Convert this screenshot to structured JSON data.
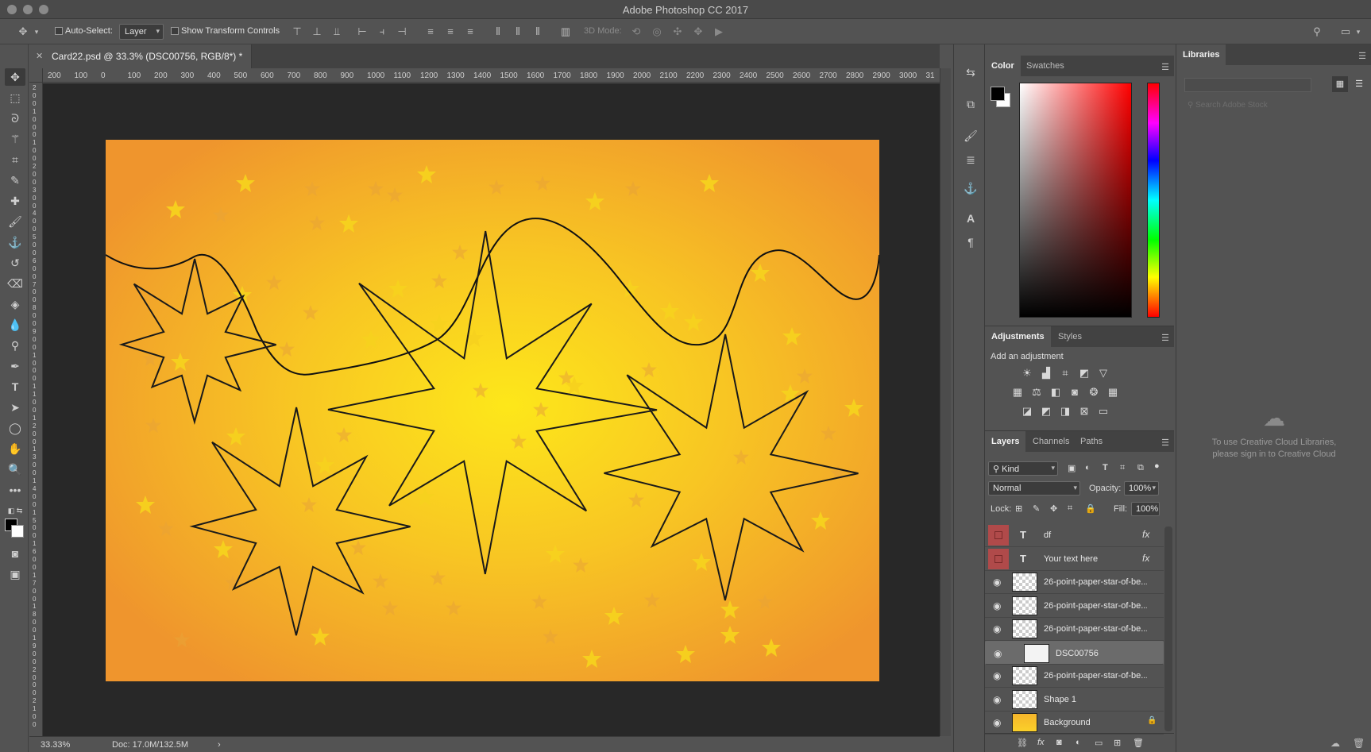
{
  "window": {
    "title": "Adobe Photoshop CC 2017"
  },
  "options_bar": {
    "auto_select_label": "Auto-Select:",
    "auto_select_value": "Layer",
    "show_transform_label": "Show Transform Controls",
    "mode_3d_label": "3D Mode:"
  },
  "document": {
    "tab_title": "Card22.psd @ 33.3% (DSC00756, RGB/8*) *",
    "ruler_ticks": [
      "200",
      "100",
      "0",
      "100",
      "200",
      "300",
      "400",
      "500",
      "600",
      "700",
      "800",
      "900",
      "1000",
      "1100",
      "1200",
      "1300",
      "1400",
      "1500",
      "1600",
      "1700",
      "1800",
      "1900",
      "2000",
      "2100",
      "2200",
      "2300",
      "2400",
      "2500",
      "2600",
      "2700",
      "2800",
      "2900",
      "3000",
      "31"
    ],
    "vruler_ticks": [
      "2",
      "0",
      "0",
      "1",
      "0",
      "0",
      "0",
      "1",
      "0",
      "0",
      "2",
      "0",
      "0",
      "3",
      "0",
      "0",
      "4",
      "0",
      "0",
      "5",
      "0",
      "0",
      "6",
      "0",
      "0",
      "7",
      "0",
      "0",
      "8",
      "0",
      "0",
      "9",
      "0",
      "0",
      "1",
      "0",
      "0",
      "0",
      "1",
      "1",
      "0",
      "0",
      "1",
      "2",
      "0",
      "0",
      "1",
      "3",
      "0",
      "0",
      "1",
      "4",
      "0",
      "0",
      "1",
      "5",
      "0",
      "0",
      "1",
      "6",
      "0",
      "0",
      "1",
      "7",
      "0",
      "0",
      "1",
      "8",
      "0",
      "0",
      "1",
      "9",
      "0",
      "0",
      "2",
      "0",
      "0",
      "0",
      "2",
      "1",
      "0",
      "0"
    ]
  },
  "status": {
    "zoom": "33.33%",
    "doc_size": "Doc: 17.0M/132.5M"
  },
  "color_panel": {
    "tabs": [
      "Color",
      "Swatches"
    ],
    "foreground": "#000000",
    "background": "#ffffff"
  },
  "adjustments_panel": {
    "tabs": [
      "Adjustments",
      "Styles"
    ],
    "heading": "Add an adjustment"
  },
  "layers_panel": {
    "tabs": [
      "Layers",
      "Channels",
      "Paths"
    ],
    "filter_kind": "Kind",
    "blend_mode": "Normal",
    "opacity_label": "Opacity:",
    "opacity_value": "100%",
    "lock_label": "Lock:",
    "fill_label": "Fill:",
    "fill_value": "100%",
    "layers": [
      {
        "name": "df",
        "type": "text",
        "fx": "fx",
        "visible": false
      },
      {
        "name": "Your text here",
        "type": "text",
        "fx": "fx",
        "visible": false
      },
      {
        "name": "26-point-paper-star-of-be...",
        "type": "pixel",
        "visible": true
      },
      {
        "name": "26-point-paper-star-of-be...",
        "type": "pixel",
        "visible": true
      },
      {
        "name": "26-point-paper-star-of-be...",
        "type": "pixel",
        "visible": true
      },
      {
        "name": "DSC00756",
        "type": "smart",
        "visible": true,
        "selected": true
      },
      {
        "name": "26-point-paper-star-of-be...",
        "type": "pixel",
        "visible": true
      },
      {
        "name": "Shape 1",
        "type": "shape",
        "visible": true
      },
      {
        "name": "Background",
        "type": "background",
        "visible": true,
        "locked": true
      }
    ]
  },
  "libraries_panel": {
    "tab": "Libraries",
    "search_placeholder": "Search Adobe Stock",
    "signin_line1": "To use Creative Cloud Libraries,",
    "signin_line2": "please sign in to Creative Cloud"
  },
  "colors": {
    "artwork_inner": "#fde21a",
    "artwork_outer": "#ef962c",
    "star_fill": "#f7d21e",
    "star_dim": "#e9a437"
  }
}
